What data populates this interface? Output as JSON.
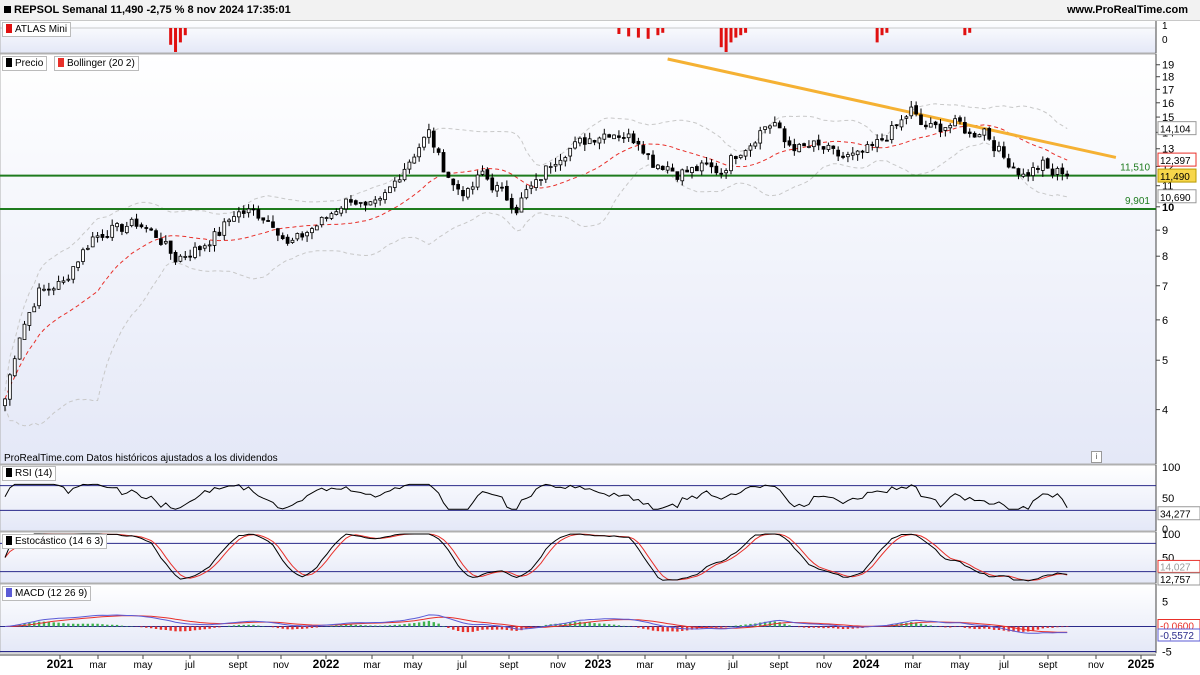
{
  "header": {
    "title": "REPSOL Semanal 11,490 -2,75 % 8 nov 2024 17:35:01",
    "source": "www.ProRealTime.com"
  },
  "panels": {
    "atlas": "ATLAS Mini",
    "precio": "Precio",
    "bollinger": "Bollinger (20 2)",
    "rsi": "RSI (14)",
    "stoch": "Estocástico (14 6 3)",
    "macd": "MACD (12 26 9)"
  },
  "footnote": "ProRealTime.com  Datos históricos ajustados a los dividendos",
  "colors": {
    "up": "#ffffff",
    "down": "#000000",
    "bollinger_mid": "#e8302a",
    "bollinger_band": "#c8c8c8",
    "trendline": "#f5b133",
    "support": "#1e7b1e",
    "rsi": "#000000",
    "stoch_k": "#000000",
    "stoch_d": "#e8302a",
    "macd": "#5b5bd6",
    "signal": "#e8302a",
    "atlas": "#e01010"
  },
  "chart_data": {
    "type": "candlestick",
    "price_axis": {
      "min": 3.2,
      "max": 19.5,
      "scale": "log",
      "ticks": [
        4,
        5,
        6,
        7,
        8,
        9,
        10,
        11,
        12,
        13,
        14,
        15,
        16,
        17,
        18,
        19
      ],
      "tick_labels": [
        "4",
        "5",
        "6",
        "7",
        "8",
        "9",
        "10",
        "11",
        "12",
        "13",
        "14",
        "15",
        "16",
        "17",
        "18",
        "19"
      ]
    },
    "x_axis": {
      "labels": [
        "2021",
        "mar",
        "may",
        "jul",
        "sept",
        "nov",
        "2022",
        "mar",
        "may",
        "jul",
        "sept",
        "nov",
        "2023",
        "mar",
        "may",
        "jul",
        "sept",
        "nov",
        "2024",
        "mar",
        "may",
        "jul",
        "sept",
        "nov",
        "2025"
      ]
    },
    "price_anchors": [
      [
        0,
        4.2
      ],
      [
        3,
        5.6
      ],
      [
        7,
        6.8
      ],
      [
        12,
        7.1
      ],
      [
        18,
        8.7
      ],
      [
        22,
        9.0
      ],
      [
        27,
        9.3
      ],
      [
        31,
        8.8
      ],
      [
        35,
        7.9
      ],
      [
        40,
        8.3
      ],
      [
        44,
        8.9
      ],
      [
        47,
        9.7
      ],
      [
        51,
        9.8
      ],
      [
        55,
        9.3
      ],
      [
        58,
        8.4
      ],
      [
        61,
        8.8
      ],
      [
        64,
        9.2
      ],
      [
        68,
        9.9
      ],
      [
        71,
        10.4
      ],
      [
        74,
        9.9
      ],
      [
        77,
        10.2
      ],
      [
        80,
        11.2
      ],
      [
        84,
        12.7
      ],
      [
        87,
        14.0
      ],
      [
        89,
        12.5
      ],
      [
        92,
        11.0
      ],
      [
        95,
        10.6
      ],
      [
        98,
        11.7
      ],
      [
        100,
        11.0
      ],
      [
        102,
        10.7
      ],
      [
        105,
        9.9
      ],
      [
        107,
        10.7
      ],
      [
        109,
        11.1
      ],
      [
        112,
        12.2
      ],
      [
        115,
        12.8
      ],
      [
        118,
        13.4
      ],
      [
        121,
        13.7
      ],
      [
        124,
        14.0
      ],
      [
        127,
        13.8
      ],
      [
        130,
        13.5
      ],
      [
        133,
        12.2
      ],
      [
        136,
        12.0
      ],
      [
        138,
        11.6
      ],
      [
        141,
        11.8
      ],
      [
        144,
        12.0
      ],
      [
        147,
        11.7
      ],
      [
        150,
        12.7
      ],
      [
        153,
        13.3
      ],
      [
        156,
        14.4
      ],
      [
        158,
        14.6
      ],
      [
        160,
        13.4
      ],
      [
        163,
        13.0
      ],
      [
        166,
        13.2
      ],
      [
        169,
        12.9
      ],
      [
        172,
        12.5
      ],
      [
        175,
        12.6
      ],
      [
        178,
        13.1
      ],
      [
        181,
        13.8
      ],
      [
        184,
        14.7
      ],
      [
        186,
        15.5
      ],
      [
        188,
        14.5
      ],
      [
        190,
        14.3
      ],
      [
        193,
        14.4
      ],
      [
        196,
        14.6
      ],
      [
        198,
        13.8
      ],
      [
        201,
        14.2
      ],
      [
        203,
        13.2
      ],
      [
        205,
        12.5
      ],
      [
        207,
        12.0
      ],
      [
        209,
        11.5
      ],
      [
        211,
        11.8
      ],
      [
        213,
        12.1
      ],
      [
        215,
        11.6
      ],
      [
        217,
        11.8
      ],
      [
        218,
        11.49
      ]
    ],
    "last_close": 11.49,
    "price_labels": {
      "bollinger_upper": "14,104",
      "bollinger_mid": "12,397",
      "bollinger_lower": "10,690",
      "last": "11,490"
    },
    "trendline": {
      "points": [
        {
          "week": 136,
          "price": 19.5
        },
        {
          "week": 228,
          "price": 12.5
        }
      ]
    },
    "support_levels": [
      {
        "value": 11.51,
        "label": "11,510"
      },
      {
        "value": 9.901,
        "label": "9,901"
      }
    ],
    "atlas_ticks": [
      "1",
      "0"
    ],
    "atlas_bars": [
      [
        35,
        -1.0
      ],
      [
        36,
        -0.6
      ],
      [
        34,
        -0.7
      ],
      [
        37,
        -0.3
      ],
      [
        126,
        -0.25
      ],
      [
        128,
        -0.35
      ],
      [
        130,
        -0.4
      ],
      [
        132,
        -0.45
      ],
      [
        134,
        -0.3
      ],
      [
        135,
        -0.2
      ],
      [
        147,
        -0.8
      ],
      [
        148,
        -1.0
      ],
      [
        149,
        -0.6
      ],
      [
        150,
        -0.4
      ],
      [
        151,
        -0.3
      ],
      [
        152,
        -0.2
      ],
      [
        179,
        -0.6
      ],
      [
        180,
        -0.3
      ],
      [
        181,
        -0.2
      ],
      [
        197,
        -0.3
      ],
      [
        198,
        -0.2
      ]
    ],
    "rsi": {
      "ticks": [
        100,
        50,
        0
      ],
      "levels": [
        70,
        30
      ],
      "last_label": "34,277"
    },
    "stochastic": {
      "ticks": [
        100,
        50,
        0
      ],
      "levels": [
        80,
        20
      ],
      "k_label": "14,027",
      "d_label": "12,757"
    },
    "macd": {
      "ticks": [
        5,
        0,
        -5
      ],
      "macd_label": "-0,0600",
      "signal_label": "-0,5572"
    }
  }
}
